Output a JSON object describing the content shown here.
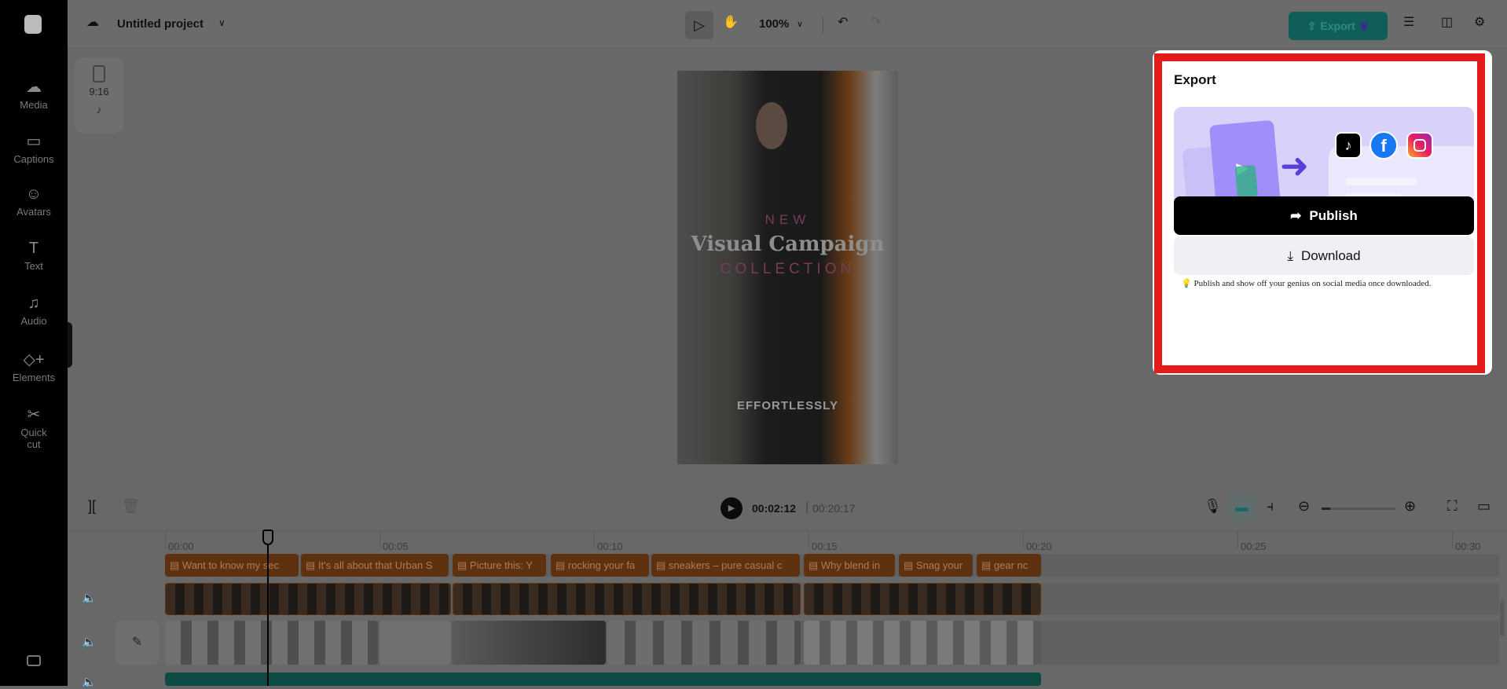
{
  "topbar": {
    "project_title": "Untitled project",
    "zoom": "100%",
    "export_label": "Export"
  },
  "sidebar": {
    "items": [
      {
        "label": "Media"
      },
      {
        "label": "Captions"
      },
      {
        "label": "Avatars"
      },
      {
        "label": "Text"
      },
      {
        "label": "Audio"
      },
      {
        "label": "Elements"
      },
      {
        "label": "Quick cut"
      }
    ]
  },
  "canvas": {
    "ratio": "9:16",
    "overlay": {
      "line1": "NEW",
      "line2": "Visual Campaign",
      "line3": "COLLECTION",
      "subtitle": "EFFORTLESSLY"
    }
  },
  "playback": {
    "current": "00:02:12",
    "total": "00:20:17"
  },
  "ruler": [
    "00:00",
    "00:05",
    "00:10",
    "00:15",
    "00:20",
    "00:25",
    "00:30"
  ],
  "captions": [
    "Want to know my sec",
    "It's all about that Urban S",
    "Picture this: Y",
    "rocking your fa",
    "sneakers – pure casual c",
    "Why blend in",
    "Snag your",
    "gear nc"
  ],
  "export_panel": {
    "title": "Export",
    "publish_label": "Publish",
    "download_label": "Download",
    "note": "Publish and show off your genius on social media once downloaded.",
    "colors": {
      "frame": "#e31b1b",
      "publish_bg": "#000000"
    }
  }
}
